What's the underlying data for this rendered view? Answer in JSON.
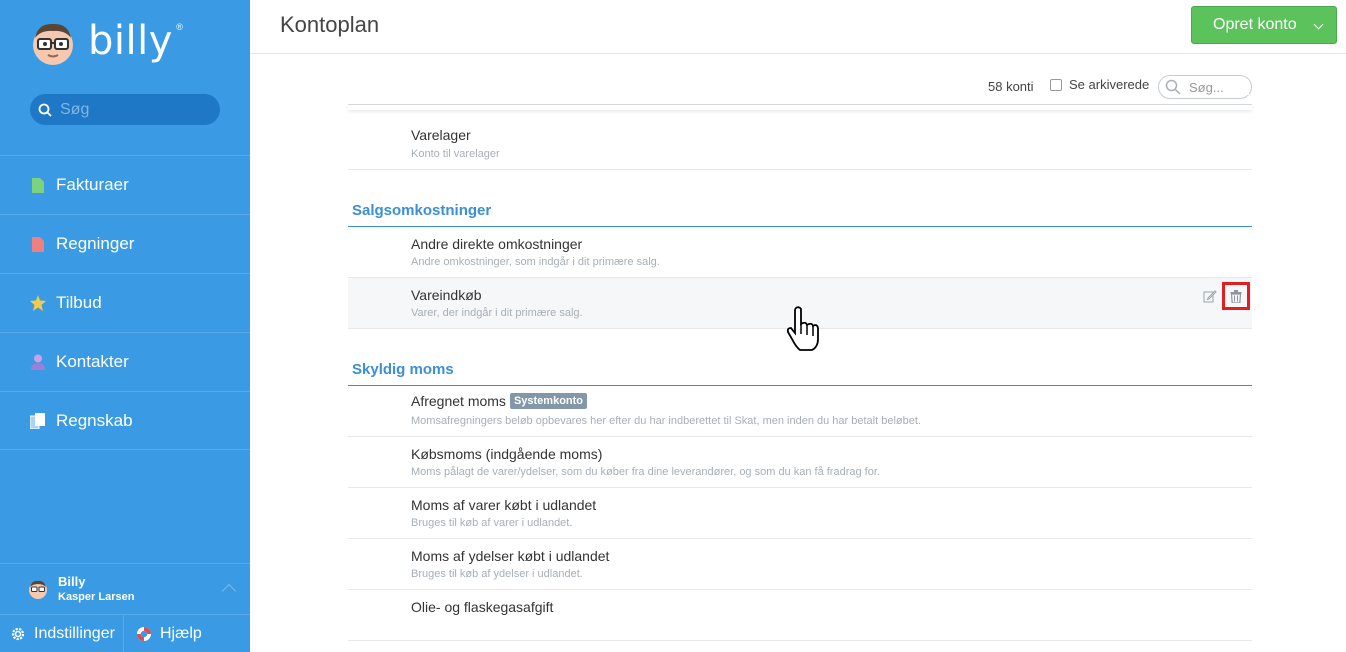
{
  "sidebar": {
    "brand": "billy",
    "search_placeholder": "Søg",
    "items": [
      {
        "label": "Fakturaer",
        "icon": "invoice-icon",
        "color": "#7dd37d"
      },
      {
        "label": "Regninger",
        "icon": "bill-icon",
        "color": "#f08080"
      },
      {
        "label": "Tilbud",
        "icon": "star-icon",
        "color": "#f5c94a"
      },
      {
        "label": "Kontakter",
        "icon": "person-icon",
        "color": "#9b7fd8"
      },
      {
        "label": "Regnskab",
        "icon": "book-icon",
        "color": "#ffffff"
      }
    ],
    "user": {
      "name": "Billy",
      "subtitle": "Kasper Larsen"
    },
    "settings_label": "Indstillinger",
    "help_label": "Hjælp"
  },
  "header": {
    "title": "Kontoplan",
    "create_label": "Opret konto"
  },
  "toolbar": {
    "count": "58 konti",
    "archived_label": "Se arkiverede",
    "search_placeholder": "Søg..."
  },
  "accounts": {
    "varelager": {
      "name": "Varelager",
      "desc": "Konto til varelager"
    },
    "section1": "Salgsomkostninger",
    "andre": {
      "name": "Andre direkte omkostninger",
      "desc": "Andre omkostninger, som indgår i dit primære salg."
    },
    "vareindkob": {
      "name": "Vareindkøb",
      "desc": "Varer, der indgår i dit primære salg."
    },
    "section2": "Skyldig moms",
    "afregnet": {
      "name": "Afregnet moms",
      "badge": "Systemkonto",
      "desc": "Momsafregningers beløb opbevares her efter du har indberettet til Skat, men inden du har betalt beløbet."
    },
    "kobsmoms": {
      "name": "Købsmoms (indgående moms)",
      "desc": "Moms pålagt de varer/ydelser, som du køber fra dine leverandører, og som du kan få fradrag for."
    },
    "moms_varer": {
      "name": "Moms af varer købt i udlandet",
      "desc": "Bruges til køb af varer i udlandet."
    },
    "moms_ydelser": {
      "name": "Moms af ydelser købt i udlandet",
      "desc": "Bruges til køb af ydelser i udlandet."
    },
    "olie": {
      "name": "Olie- og flaskegasafgift",
      "desc": ""
    }
  },
  "colors": {
    "sidebar": "#3a9ae3",
    "accent": "#3a8fd6",
    "create_button": "#5cc35c",
    "delete_highlight": "#e02020"
  }
}
